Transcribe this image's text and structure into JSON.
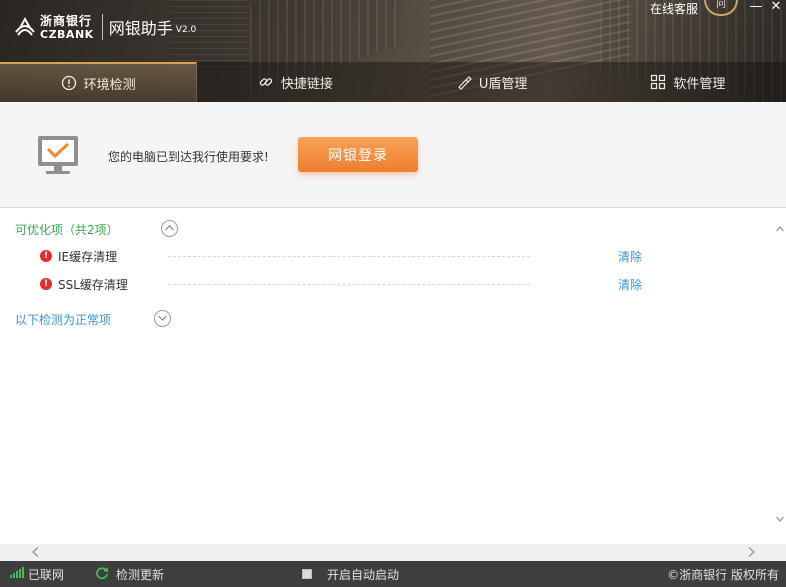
{
  "header": {
    "logo_cn": "浙商银行",
    "logo_en": "CZBANK",
    "app_title": "网银助手",
    "version": "V2.0",
    "service_link": "在线客服",
    "help_label": "问"
  },
  "window_controls": {
    "minimize": "—",
    "close": "✕"
  },
  "tabs": [
    {
      "label": "环境检测",
      "icon": "check-circle-icon",
      "active": true
    },
    {
      "label": "快捷链接",
      "icon": "link-icon",
      "active": false
    },
    {
      "label": "U盾管理",
      "icon": "usb-key-icon",
      "active": false
    },
    {
      "label": "软件管理",
      "icon": "apps-grid-icon",
      "active": false
    }
  ],
  "status": {
    "message": "您的电脑已到达我行使用要求!",
    "login_button": "网银登录"
  },
  "optimizable": {
    "title": "可优化项（共2项）",
    "items": [
      {
        "label": "IE缓存清理",
        "action": "清除"
      },
      {
        "label": "SSL缓存清理",
        "action": "清除"
      }
    ]
  },
  "normal": {
    "title": "以下检测为正常项"
  },
  "footer": {
    "network": "已联网",
    "update": "检测更新",
    "autostart": "开启自动启动",
    "copyright": "©浙商银行 版权所有"
  },
  "colors": {
    "accent": "#ef7f2f",
    "green": "#3aa94e",
    "link": "#3796cf",
    "warning": "#e52b2b"
  }
}
